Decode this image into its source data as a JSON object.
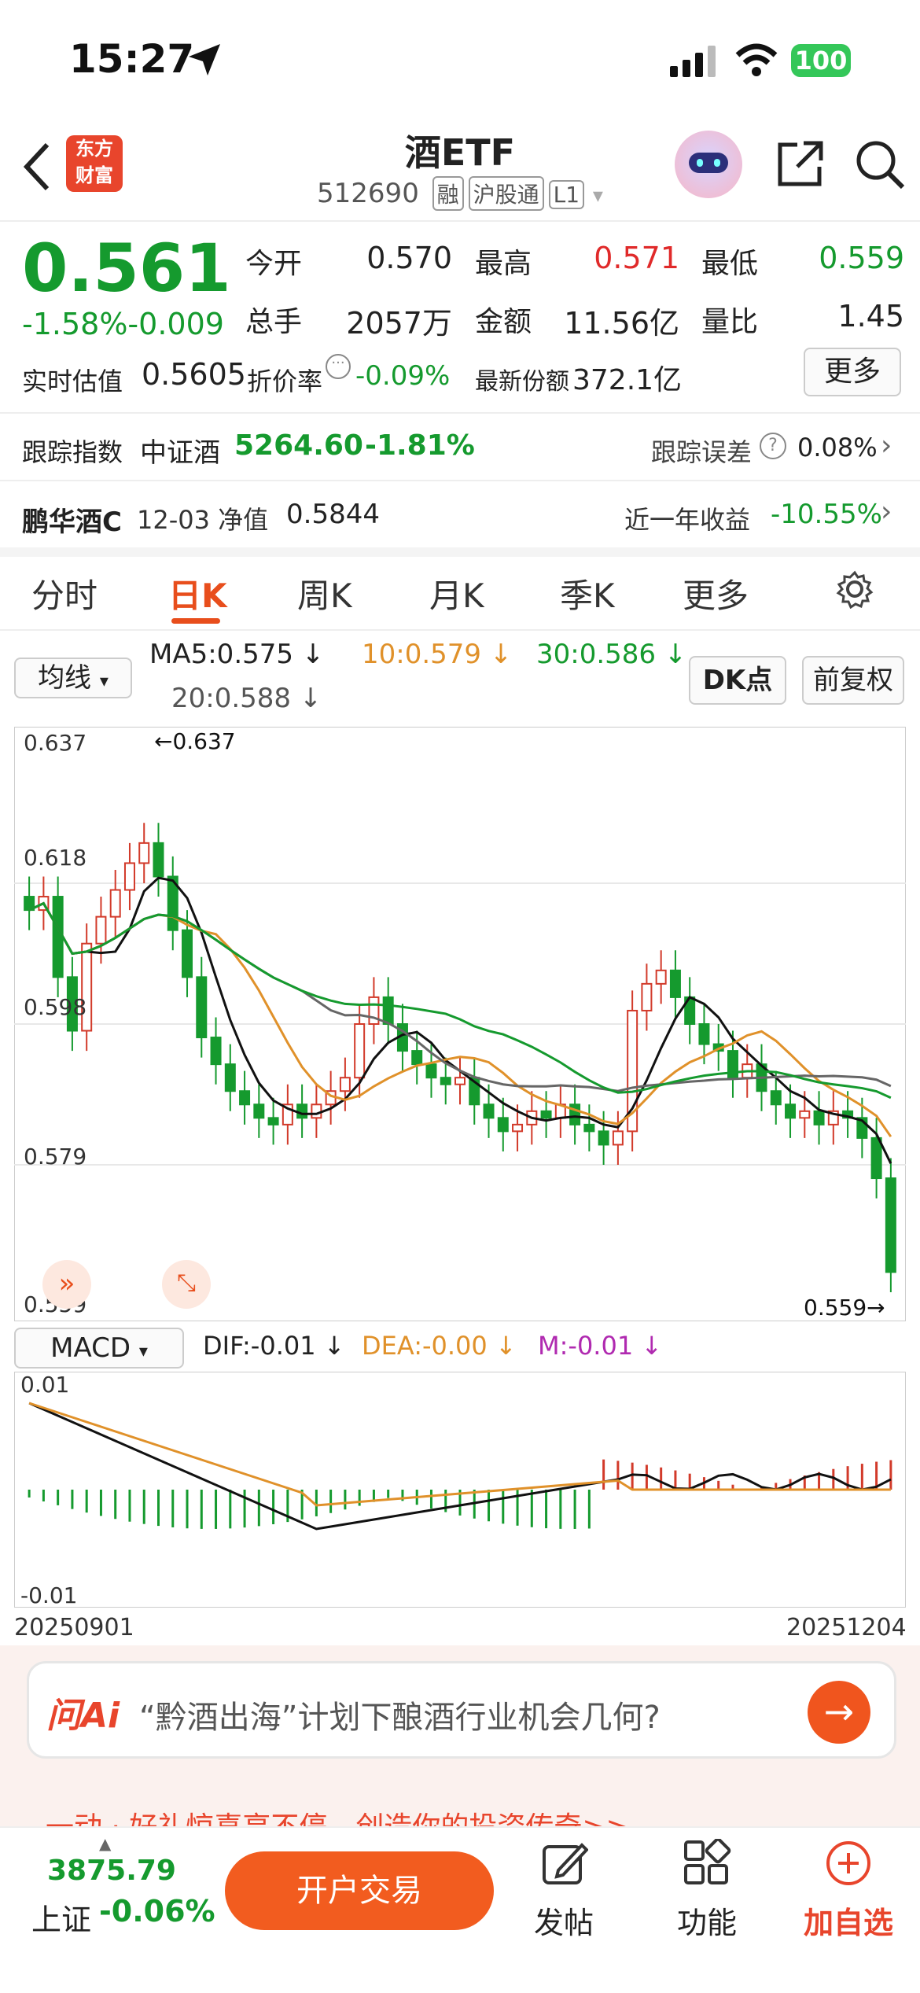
{
  "status_bar": {
    "time": "15:27",
    "battery": "100"
  },
  "header": {
    "title": "酒ETF",
    "code": "512690",
    "tags": [
      "融",
      "沪股通",
      "L1"
    ]
  },
  "quote": {
    "price": "0.561",
    "change": "-1.58%-0.009",
    "open_label": "今开",
    "open": "0.570",
    "high_label": "最高",
    "high": "0.571",
    "low_label": "最低",
    "low": "0.559",
    "volume_label": "总手",
    "volume": "2057万",
    "amount_label": "金额",
    "amount": "11.56亿",
    "ratio_label": "量比",
    "ratio": "1.45",
    "estimate_label": "实时估值",
    "estimate": "0.5605",
    "discount_label": "折价率",
    "discount": "-0.09%",
    "shares_label": "最新份额",
    "shares": "372.1亿",
    "more_label": "更多"
  },
  "tracking": {
    "label": "跟踪指数",
    "index_name": "中证酒",
    "index_value": "5264.60",
    "index_change": "-1.81%",
    "error_label": "跟踪误差",
    "error_value": "0.08%"
  },
  "fund": {
    "name": "鹏华酒C",
    "date_nav": "12-03 净值",
    "nav": "0.5844",
    "year_label": "近一年收益",
    "year_value": "-10.55%"
  },
  "tabs": [
    "分时",
    "日K",
    "周K",
    "月K",
    "季K",
    "更多"
  ],
  "chart_controls": {
    "ma_select": "均线",
    "ma5": "MA5:0.575 ↓",
    "ma10": "10:0.579 ↓",
    "ma30": "30:0.586 ↓",
    "ma20": "20:0.588 ↓",
    "dk_button": "DK点",
    "adjust_button": "前复权"
  },
  "kline": {
    "y_labels": [
      "0.637",
      "0.618",
      "0.598",
      "0.579",
      "0.559"
    ],
    "high_marker": "←0.637",
    "low_marker": "0.559→",
    "colors": {
      "up": "#d23a2a",
      "down": "#159a2e",
      "ma5": "#111111",
      "ma10": "#e0912a",
      "ma20": "#666666",
      "ma30": "#159a2e"
    }
  },
  "macd": {
    "select": "MACD",
    "dif": "DIF:-0.01 ↓",
    "dea": "DEA:-0.00 ↓",
    "m": "M:-0.01 ↓",
    "y_top": "0.01",
    "y_bottom": "-0.01",
    "date_start": "20250901",
    "date_end": "20251204"
  },
  "ai_bar": {
    "logo": "问Ai",
    "question": "“黔酒出海”计划下酿酒行业机会几何?"
  },
  "banner": {
    "text": "一动 · 好礼惊喜享不停，创造你的投资传奇>>"
  },
  "bottom_bar": {
    "index_value": "3875.79",
    "index_name": "上证",
    "index_change": "-0.06%",
    "trade_button": "开户交易",
    "post_label": "发帖",
    "function_label": "功能",
    "watch_label": "加自选"
  }
}
